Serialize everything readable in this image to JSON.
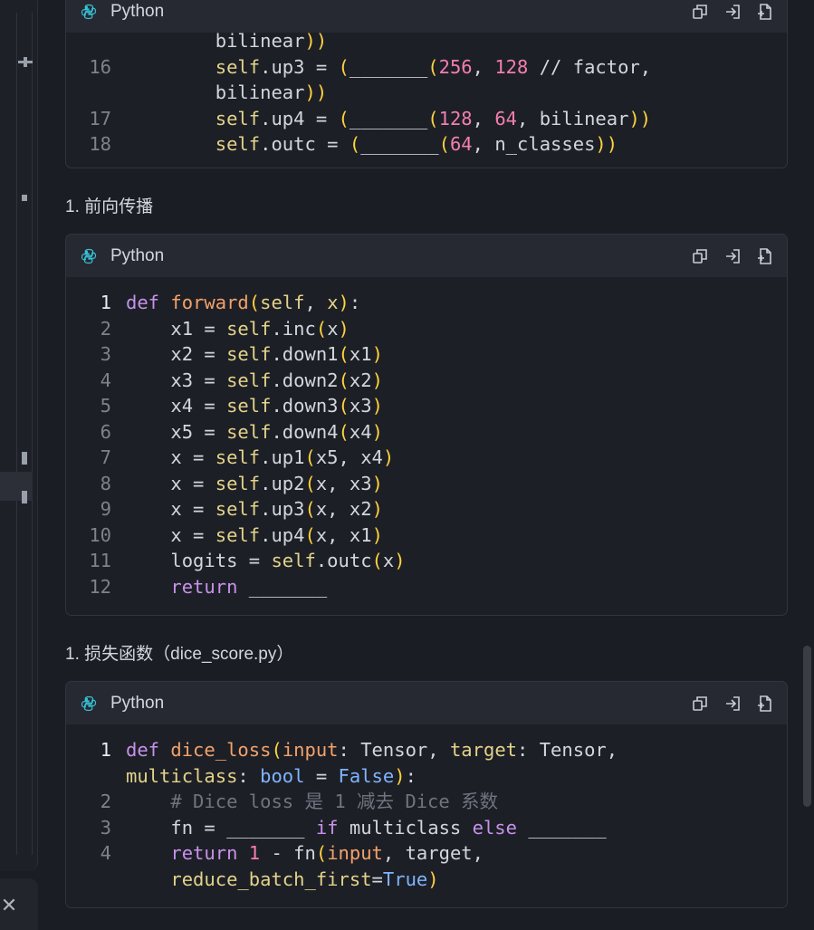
{
  "language_label": "Python",
  "tool_icons": [
    "copy-icon",
    "insert-icon",
    "new-file-icon"
  ],
  "headings": {
    "forward": "1. 前向传播",
    "loss": "1. 损失函数（dice_score.py）"
  },
  "card1": {
    "lines": [
      {
        "n": "",
        "html": "<span class='pl'>bilinear</span><span class='par'>))</span>",
        "indent": 8
      },
      {
        "n": "16",
        "html": "<span class='sf'>self</span>.up3 = <span class='par'>(</span>_______<span class='par'>(</span><span class='num'>256</span>, <span class='num'>128</span> // factor,",
        "indent": 8
      },
      {
        "n": "",
        "html": "bilinear<span class='par'>))</span>",
        "indent": 8
      },
      {
        "n": "17",
        "html": "<span class='sf'>self</span>.up4 = <span class='par'>(</span>_______<span class='par'>(</span><span class='num'>128</span>, <span class='num'>64</span>, bilinear<span class='par'>))</span>",
        "indent": 8
      },
      {
        "n": "18",
        "html": "<span class='sf'>self</span>.outc = <span class='par'>(</span>_______<span class='par'>(</span><span class='num'>64</span>, n_classes<span class='par'>))</span>",
        "indent": 8
      }
    ]
  },
  "card2": {
    "lines": [
      {
        "n": "1",
        "active": true,
        "html": "<span class='kw'>def</span> <span class='fn'>forward</span><span class='par'>(</span><span class='sf'>self</span>, <span class='sf'>x</span><span class='par'>)</span>:",
        "indent": 0
      },
      {
        "n": "2",
        "html": "x1 = <span class='sf'>self</span>.inc<span class='par'>(</span>x<span class='par'>)</span>",
        "indent": 4
      },
      {
        "n": "3",
        "html": "x2 = <span class='sf'>self</span>.down1<span class='par'>(</span>x1<span class='par'>)</span>",
        "indent": 4
      },
      {
        "n": "4",
        "html": "x3 = <span class='sf'>self</span>.down2<span class='par'>(</span>x2<span class='par'>)</span>",
        "indent": 4
      },
      {
        "n": "5",
        "html": "x4 = <span class='sf'>self</span>.down3<span class='par'>(</span>x3<span class='par'>)</span>",
        "indent": 4
      },
      {
        "n": "6",
        "html": "x5 = <span class='sf'>self</span>.down4<span class='par'>(</span>x4<span class='par'>)</span>",
        "indent": 4
      },
      {
        "n": "7",
        "html": "x = <span class='sf'>self</span>.up1<span class='par'>(</span>x5, x4<span class='par'>)</span>",
        "indent": 4
      },
      {
        "n": "8",
        "html": "x = <span class='sf'>self</span>.up2<span class='par'>(</span>x, x3<span class='par'>)</span>",
        "indent": 4
      },
      {
        "n": "9",
        "html": "x = <span class='sf'>self</span>.up3<span class='par'>(</span>x, x2<span class='par'>)</span>",
        "indent": 4
      },
      {
        "n": "10",
        "html": "x = <span class='sf'>self</span>.up4<span class='par'>(</span>x, x1<span class='par'>)</span>",
        "indent": 4
      },
      {
        "n": "11",
        "html": "logits = <span class='sf'>self</span>.outc<span class='par'>(</span>x<span class='par'>)</span>",
        "indent": 4
      },
      {
        "n": "12",
        "html": "<span class='kw'>return</span> _______",
        "indent": 4
      }
    ]
  },
  "card3": {
    "lines": [
      {
        "n": "1",
        "active": true,
        "html": "<span class='kw'>def</span> <span class='fn'>dice_loss</span><span class='par'>(</span><span class='fn'>input</span>: Tensor, <span class='sf'>target</span>: Tensor,",
        "indent": 0
      },
      {
        "n": "",
        "html": "<span class='sf'>multiclass</span>: <span class='bool'>bool</span> = <span class='bool'>False</span><span class='par'>)</span>:",
        "indent": 0
      },
      {
        "n": "2",
        "html": "<span class='cm'># Dice loss 是 1 减去 Dice 系数</span>",
        "indent": 4
      },
      {
        "n": "3",
        "html": "fn = _______ <span class='kw'>if</span> multiclass <span class='kw'>else</span> _______",
        "indent": 4
      },
      {
        "n": "4",
        "html": "<span class='kw'>return</span> <span class='num'>1</span> - fn<span class='par'>(</span><span class='fn'>input</span>, target,",
        "indent": 4
      },
      {
        "n": "",
        "html": "<span class='sf'>reduce_batch_first</span>=<span class='bool'>True</span><span class='par'>)</span>",
        "indent": 4
      }
    ]
  }
}
